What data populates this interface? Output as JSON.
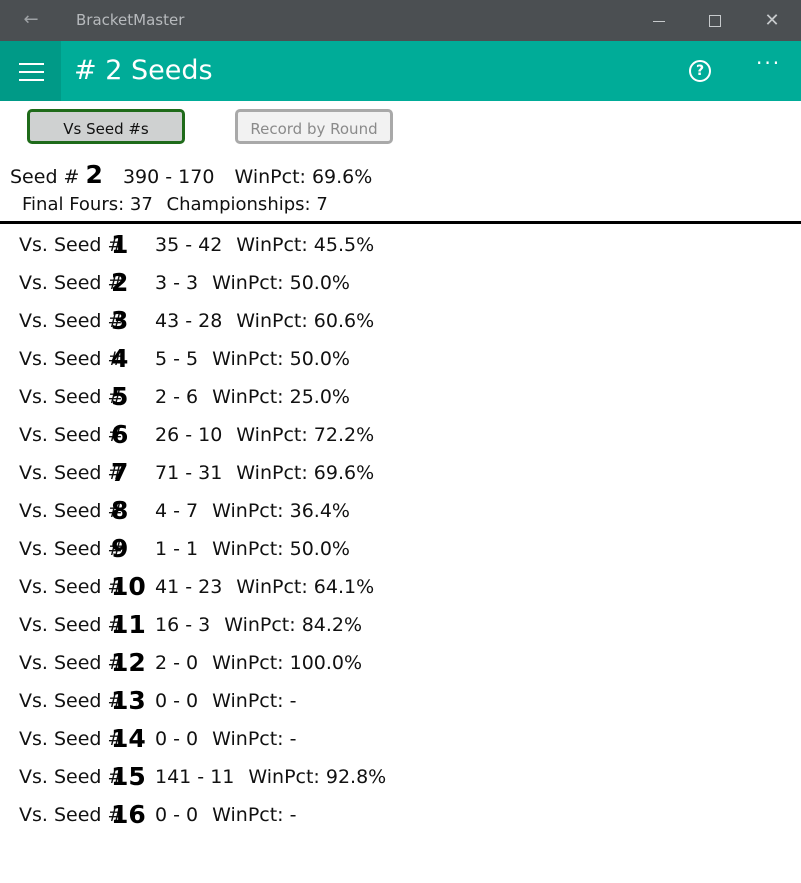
{
  "window": {
    "title": "BracketMaster",
    "back_glyph": "←",
    "close_glyph": "✕"
  },
  "appbar": {
    "title": "# 2 Seeds",
    "help_glyph": "?",
    "more_glyph": "···"
  },
  "tabs": [
    {
      "label": "Vs Seed #s",
      "active": true
    },
    {
      "label": "Record by Round",
      "active": false
    }
  ],
  "summary": {
    "seed_prefix": "Seed #",
    "seed": "2",
    "record": "390 - 170",
    "winpct": "WinPct: 69.6%",
    "final_fours": "Final Fours: 37",
    "championships": "Championships: 7"
  },
  "colors": {
    "titlebar": "#4b4f52",
    "appbar": "#00ac98",
    "hamburger_bg": "#009a87",
    "active_tab_border": "#1f6b1a"
  },
  "rows": [
    {
      "label": "Vs. Seed #",
      "seed": "1",
      "record": "35 - 42",
      "winpct": "WinPct: 45.5%"
    },
    {
      "label": "Vs. Seed #",
      "seed": "2",
      "record": "3 - 3",
      "winpct": "WinPct: 50.0%"
    },
    {
      "label": "Vs. Seed #",
      "seed": "3",
      "record": "43 - 28",
      "winpct": "WinPct: 60.6%"
    },
    {
      "label": "Vs. Seed #",
      "seed": "4",
      "record": "5 - 5",
      "winpct": "WinPct: 50.0%"
    },
    {
      "label": "Vs. Seed #",
      "seed": "5",
      "record": "2 - 6",
      "winpct": "WinPct: 25.0%"
    },
    {
      "label": "Vs. Seed #",
      "seed": "6",
      "record": "26 - 10",
      "winpct": "WinPct: 72.2%"
    },
    {
      "label": "Vs. Seed #",
      "seed": "7",
      "record": "71 - 31",
      "winpct": "WinPct: 69.6%"
    },
    {
      "label": "Vs. Seed #",
      "seed": "8",
      "record": "4 - 7",
      "winpct": "WinPct: 36.4%"
    },
    {
      "label": "Vs. Seed #",
      "seed": "9",
      "record": "1 - 1",
      "winpct": "WinPct: 50.0%"
    },
    {
      "label": "Vs. Seed #",
      "seed": "10",
      "record": "41 - 23",
      "winpct": "WinPct: 64.1%"
    },
    {
      "label": "Vs. Seed #",
      "seed": "11",
      "record": "16 - 3",
      "winpct": "WinPct: 84.2%"
    },
    {
      "label": "Vs. Seed #",
      "seed": "12",
      "record": "2 - 0",
      "winpct": "WinPct: 100.0%"
    },
    {
      "label": "Vs. Seed #",
      "seed": "13",
      "record": "0 - 0",
      "winpct": "WinPct: -"
    },
    {
      "label": "Vs. Seed #",
      "seed": "14",
      "record": "0 - 0",
      "winpct": "WinPct: -"
    },
    {
      "label": "Vs. Seed #",
      "seed": "15",
      "record": "141 - 11",
      "winpct": "WinPct: 92.8%"
    },
    {
      "label": "Vs. Seed #",
      "seed": "16",
      "record": "0 - 0",
      "winpct": "WinPct: -"
    }
  ]
}
